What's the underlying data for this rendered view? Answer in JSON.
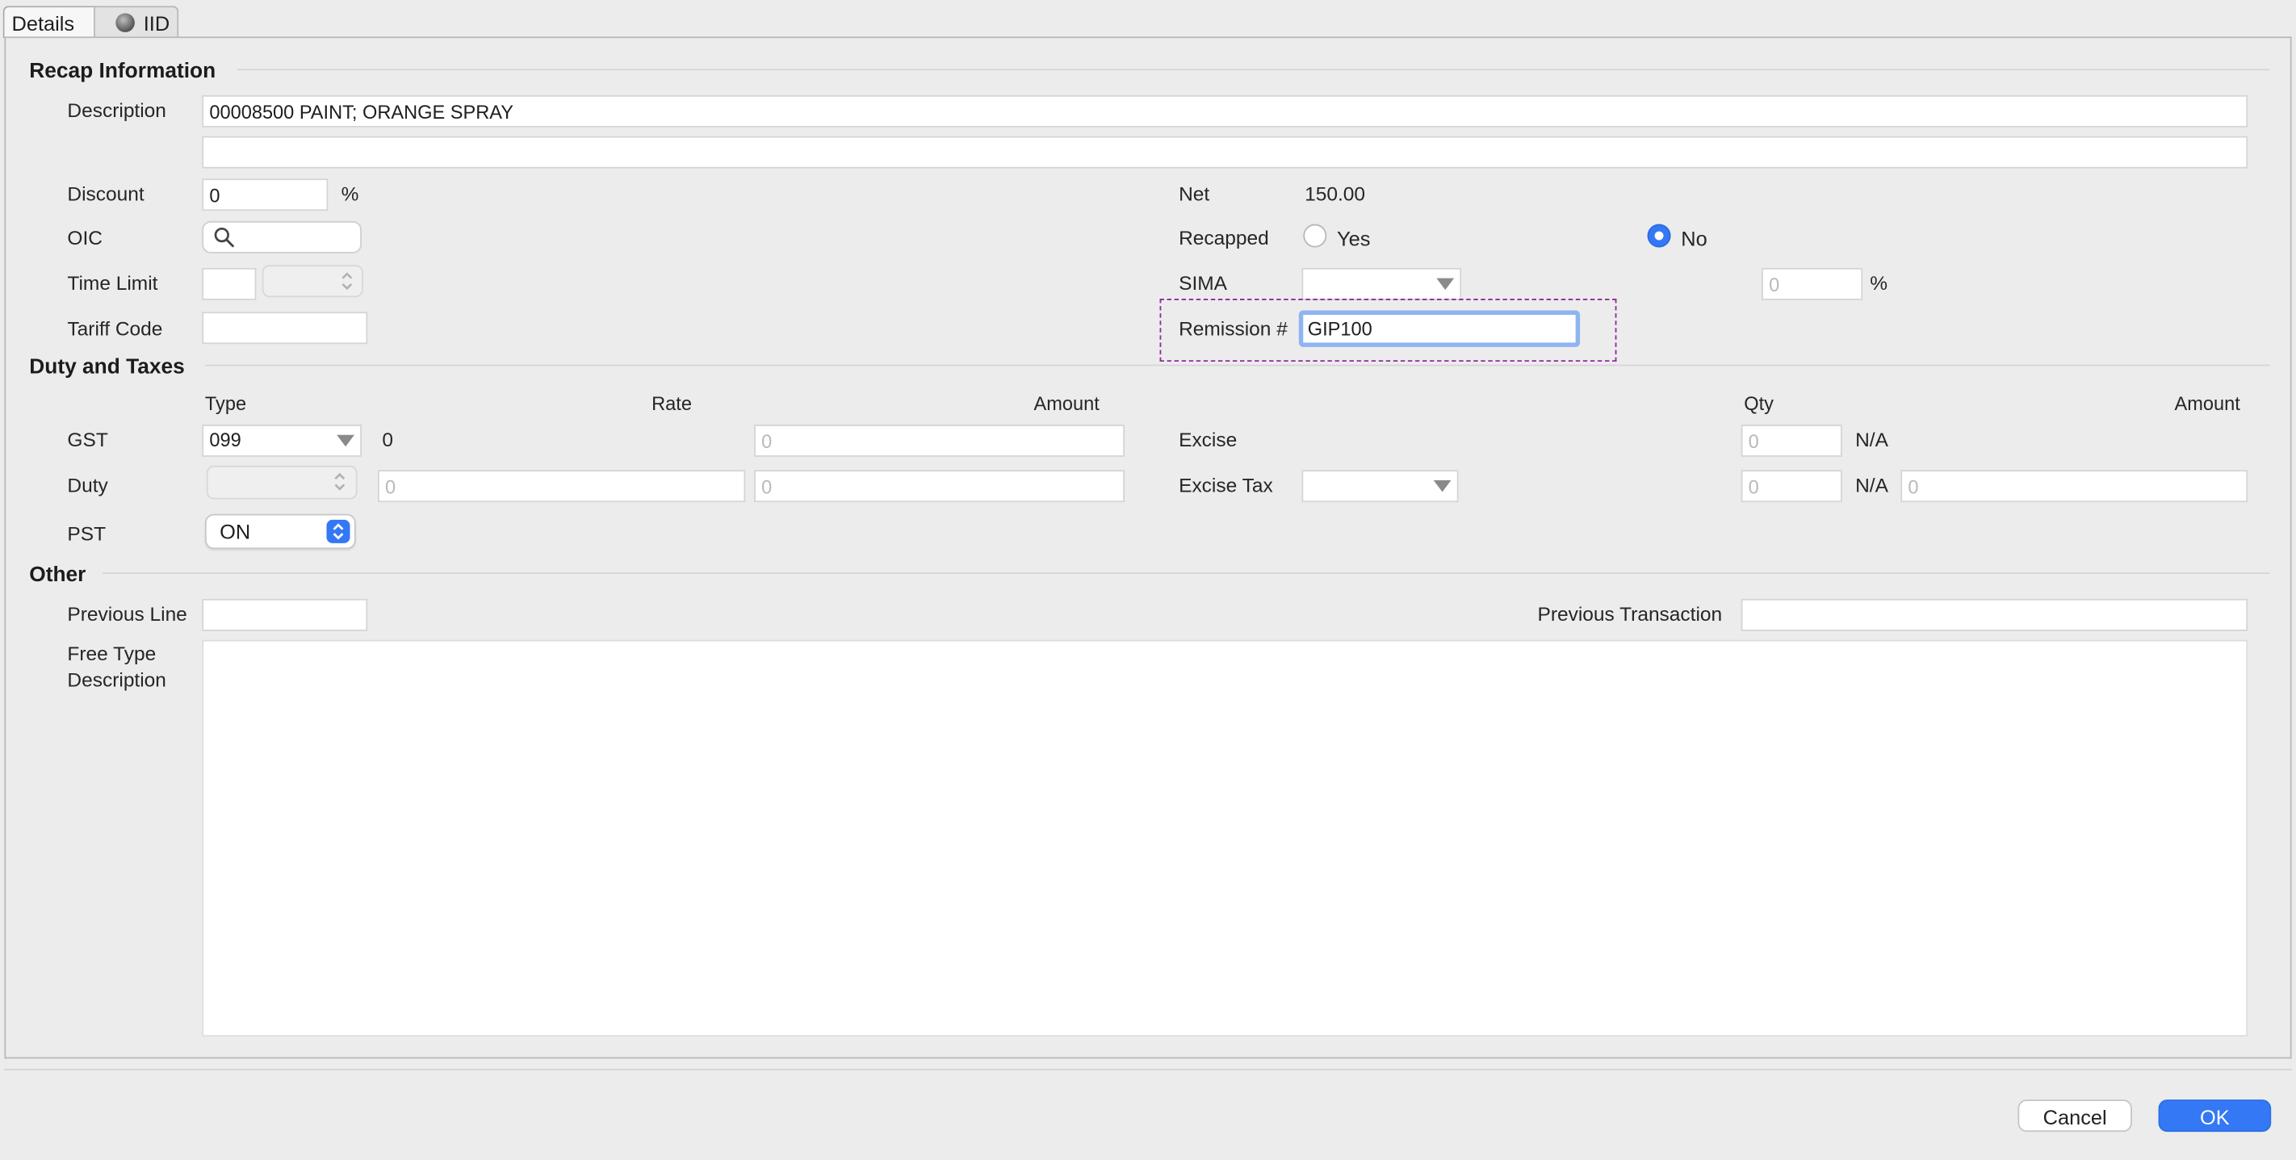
{
  "tabs": [
    {
      "label": "Details"
    },
    {
      "label": "IID"
    }
  ],
  "recap": {
    "section_title": "Recap Information",
    "description_label": "Description",
    "description_value": "00008500 PAINT; ORANGE SPRAY",
    "description_value2": "",
    "discount_label": "Discount",
    "discount_value": "0",
    "discount_unit": "%",
    "oic_label": "OIC",
    "time_limit_label": "Time Limit",
    "tariff_label": "Tariff Code",
    "net_label": "Net",
    "net_value": "150.00",
    "recapped_label": "Recapped",
    "recapped_yes": "Yes",
    "recapped_no": "No",
    "recapped_selected": "No",
    "sima_label": "SIMA",
    "sima_pct_placeholder": "0",
    "sima_pct_unit": "%",
    "remission_label": "Remission #",
    "remission_value": "GIP100"
  },
  "duty": {
    "section_title": "Duty and Taxes",
    "col_type": "Type",
    "col_rate": "Rate",
    "col_amount": "Amount",
    "col_qty": "Qty",
    "col_amount2": "Amount",
    "gst_label": "GST",
    "gst_type": "099",
    "gst_rate": "0",
    "gst_amount_placeholder": "0",
    "duty_label": "Duty",
    "duty_rate_placeholder": "0",
    "duty_amount_placeholder": "0",
    "pst_label": "PST",
    "pst_value": "ON",
    "excise_label": "Excise",
    "excise_qty_placeholder": "0",
    "excise_na": "N/A",
    "excise_tax_label": "Excise Tax",
    "excise_tax_qty_placeholder": "0",
    "excise_tax_na": "N/A",
    "excise_tax_amount_placeholder": "0"
  },
  "other": {
    "section_title": "Other",
    "previous_line_label": "Previous Line",
    "previous_transaction_label": "Previous Transaction",
    "free_type_label_1": "Free Type",
    "free_type_label_2": "Description"
  },
  "buttons": {
    "cancel": "Cancel",
    "ok": "OK"
  },
  "colors": {
    "accent": "#3478f6",
    "highlight_box": "#8e2a9a"
  }
}
